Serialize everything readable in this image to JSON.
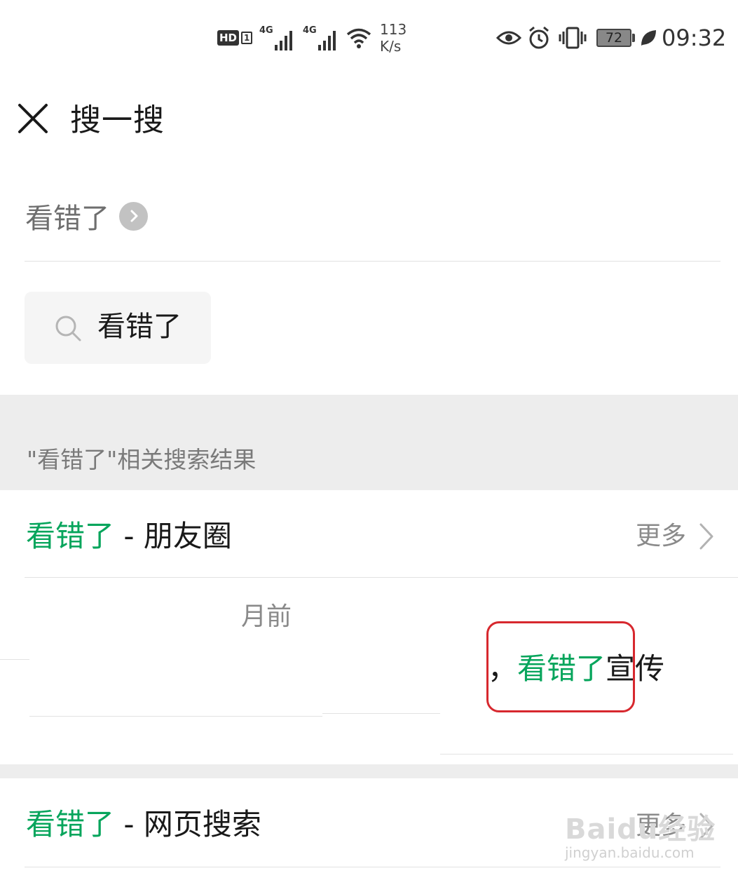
{
  "status_bar": {
    "hd_label": "HD",
    "sim_label": "1",
    "net_type_1": "4G",
    "net_type_2": "4G",
    "speed_value": "113",
    "speed_unit": "K/s",
    "battery_level": "72",
    "time": "09:32"
  },
  "header": {
    "title": "搜一搜"
  },
  "query": {
    "text": "看错了"
  },
  "search_box": {
    "value": "看错了"
  },
  "section": {
    "title": "\"看错了\"相关搜索结果"
  },
  "moments_group": {
    "keyword": "看错了",
    "suffix": " - 朋友圈",
    "more_label": "更多",
    "fragment_date": "月前",
    "fragment_prefix": "，",
    "fragment_keyword": "看错了",
    "fragment_suffix": "宣传"
  },
  "web_group": {
    "keyword": "看错了",
    "suffix": " - 网页搜索",
    "more_label": "更多"
  },
  "watermark": {
    "logo": "Baidu经验",
    "url": "jingyan.baidu.com"
  },
  "colors": {
    "accent_green": "#07a55c",
    "highlight_red": "#d7282e",
    "section_grey": "#ededed"
  }
}
